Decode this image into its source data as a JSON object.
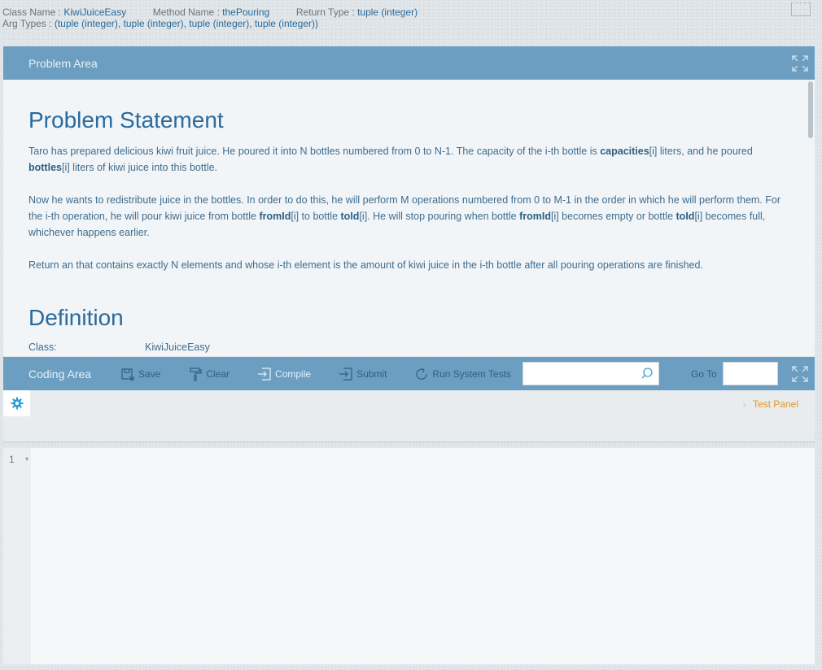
{
  "info": {
    "class_label": "Class Name :",
    "class_value": "KiwiJuiceEasy",
    "method_label": "Method Name :",
    "method_value": "thePouring",
    "return_label": "Return Type :",
    "return_value": "tuple (integer)",
    "args_label": "Arg Types :",
    "args_value": "(tuple (integer), tuple (integer), tuple (integer), tuple (integer))"
  },
  "problem": {
    "header": "Problem Area",
    "statement_title": "Problem Statement",
    "p1": {
      "a": "Taro has prepared delicious kiwi fruit juice. He poured it into N bottles numbered from 0 to N-1. The capacity of the i-th bottle is ",
      "b1": "capacities",
      "c": "[i] liters, and he poured ",
      "b2": "bottles",
      "d": "[i] liters of kiwi juice into this bottle."
    },
    "p2": {
      "a": "Now he wants to redistribute juice in the bottles. In order to do this, he will perform M operations numbered from 0 to M-1 in the order in which he will perform them. For the i-th operation, he will pour kiwi juice from bottle ",
      "b1": "fromId",
      "c": "[i] to bottle ",
      "b2": "toId",
      "d": "[i]. He will stop pouring when bottle ",
      "b3": "fromId",
      "e": "[i] becomes empty or bottle ",
      "b4": "toId",
      "f": "[i] becomes full, whichever happens earlier."
    },
    "p3": "Return an that contains exactly N elements and whose i-th element is the amount of kiwi juice in the i-th bottle after all pouring operations are finished.",
    "definition_title": "Definition",
    "def_class_label": "Class:",
    "def_class_value": "KiwiJuiceEasy"
  },
  "coding": {
    "header": "Coding Area",
    "save": "Save",
    "clear": "Clear",
    "compile": "Compile",
    "submit": "Submit",
    "run_tests": "Run System Tests",
    "search_placeholder": "",
    "goto_label": "Go To",
    "test_panel": "Test Panel",
    "line_number": "1"
  },
  "colors": {
    "header_bg": "#6c9ec1",
    "accent_text": "#2a6a9c",
    "test_panel": "#e0982c"
  }
}
